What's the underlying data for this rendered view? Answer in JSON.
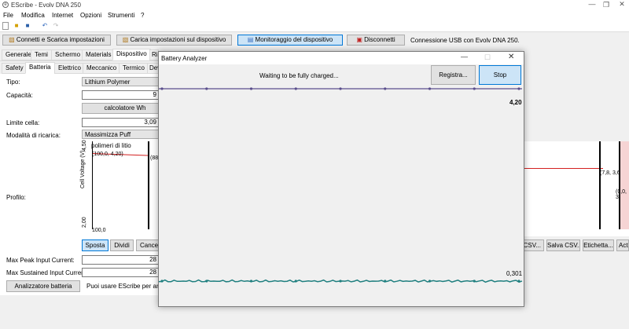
{
  "app": {
    "title": "EScribe - Evolv DNA 250"
  },
  "menu": [
    "File",
    "Modifica",
    "Internet",
    "Opzioni",
    "Strumenti",
    "?"
  ],
  "actions": {
    "connect": "Connetti e Scarica impostazioni",
    "upload": "Carica impostazioni sul dispositivo",
    "monitor": "Monitoraggio del dispositivo",
    "disconnect": "Disconnetti",
    "status": "Connessione USB con Evolv DNA 250."
  },
  "tabs_main": [
    "Generale",
    "Temi",
    "Schermo",
    "Materials",
    "Dispositivo",
    "Ri"
  ],
  "tabs_sub": [
    "Safety",
    "Batteria",
    "Elettrico",
    "Meccanico",
    "Termico",
    "Dev"
  ],
  "form": {
    "tipo_label": "Tipo:",
    "tipo_value": "Lithium Polymer",
    "capacita_label": "Capacità:",
    "capacita_value": "9",
    "calc_button": "calcolatore Wh",
    "limite_label": "Limite cella:",
    "limite_value": "3,09",
    "modalita_label": "Modalità di ricarica:",
    "modalita_value": "Massimizza Puff",
    "profilo_label": "Profilo:",
    "max_peak_label": "Max Peak Input Current:",
    "max_peak_value": "28",
    "max_sust_label": "Max Sustained Input Current:",
    "max_sust_value": "28",
    "analyzer_button": "Analizzatore batteria",
    "analyzer_text": "Puoi usare EScribe per analizz"
  },
  "profile_chart": {
    "y_axis_label": "Cell Voltage (V)",
    "y_top": "4,50",
    "y_bottom": "2,00",
    "x_left": "100,0",
    "series_name": "polimeri di litio",
    "point_label": "(100,0, 4,20)",
    "point_label2": "(88",
    "right_label1": "(7,8, 3,6",
    "right_label2": "(0,0, 3"
  },
  "chart_buttons": [
    "Sposta",
    "Dividi",
    "Cancell"
  ],
  "right_buttons": [
    "a CSV...",
    "Salva CSV...",
    "Etichetta...",
    "Acti"
  ],
  "dialog": {
    "title": "Battery Analyzer",
    "status": "Waiting to be fully charged...",
    "record_button": "Registra...",
    "stop_button": "Stop",
    "top_value": "4,20",
    "bottom_value": "0,301"
  },
  "chart_data": {
    "type": "line",
    "series": [
      {
        "values": [
          4.2,
          4.2,
          4.2,
          4.2,
          4.2,
          4.2,
          4.2,
          4.2,
          4.2
        ]
      },
      {
        "values": [
          0.301,
          0.301,
          0.301,
          0.301,
          0.301,
          0.301,
          0.301,
          0.301,
          0.301
        ]
      }
    ]
  },
  "colors": {
    "top_line": "#5a4e8c",
    "bottom_line": "#1f7f7f",
    "profile_line": "#d32020",
    "selected_button": "#cce4f7"
  }
}
